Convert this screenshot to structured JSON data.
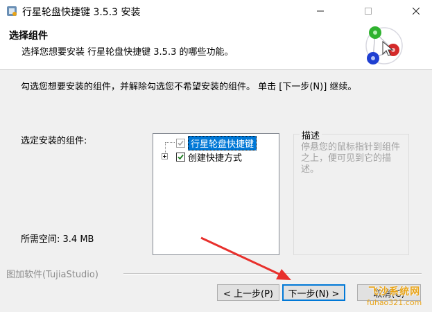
{
  "window": {
    "title": "行星轮盘快捷键 3.5.3 安装",
    "icons": {
      "app": "installer-icon",
      "minimize": "minimize-icon",
      "maximize": "maximize-icon",
      "close": "close-icon"
    }
  },
  "header": {
    "title": "选择组件",
    "subtitle": "选择您想要安装 行星轮盘快捷键 3.5.3 的哪些功能。",
    "logo_icon": "colored-balls-logo-icon"
  },
  "body": {
    "intro": "勾选您想要安装的组件，并解除勾选您不希望安装的组件。 单击 [下一步(N)] 继续。",
    "select_label": "选定安装的组件:",
    "space_label": "所需空间: 3.4 MB"
  },
  "components": [
    {
      "label": "行星轮盘快捷键",
      "checked": true,
      "disabled": true,
      "selected": true
    },
    {
      "label": "创建快捷方式",
      "checked": true,
      "disabled": false,
      "selected": false,
      "expandable": true
    }
  ],
  "description": {
    "legend": "描述",
    "text": "停悬您的鼠标指针到组件之上，便可见到它的描述。"
  },
  "brand": "图加软件(TujiaStudio)",
  "buttons": {
    "back": "< 上一步(P)",
    "next": "下一步(N) >",
    "cancel": "取消(C)"
  },
  "watermark": {
    "line1": "飞沙系统网",
    "line2": "fuhao321.com"
  },
  "colors": {
    "accent": "#0078d7",
    "arrow": "#e8302c",
    "watermark": "#e8a317"
  }
}
